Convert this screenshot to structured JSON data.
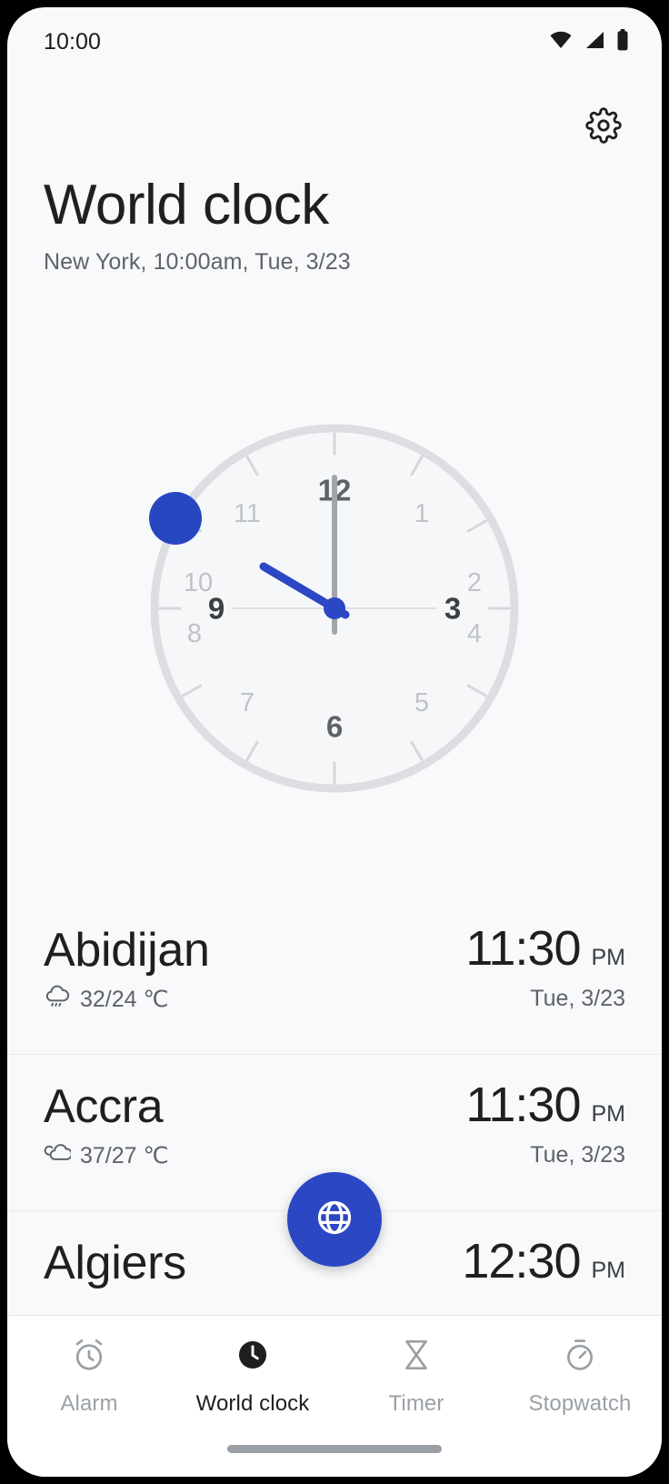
{
  "statusbar": {
    "time": "10:00",
    "icons": [
      "wifi-icon",
      "cellular-signal-icon",
      "battery-icon"
    ]
  },
  "header": {
    "settings_icon": "gear-icon",
    "title": "World clock",
    "subtitle": "New York, 10:00am, Tue, 3/23"
  },
  "clock": {
    "numbers": [
      "12",
      "1",
      "2",
      "3",
      "4",
      "5",
      "6",
      "7",
      "8",
      "9",
      "10",
      "11"
    ],
    "major_numbers": [
      "12",
      "3",
      "6",
      "9"
    ],
    "hour_hand_position": "10",
    "minute_hand_position": "12",
    "marker_dot_position": "10",
    "accent_color": "#2B47C4",
    "ring_color": "#DADCE0",
    "face_color": "#F5F6F8",
    "minute_hand_color": "#9AA0A6"
  },
  "cities": [
    {
      "name": "Abidijan",
      "weather_icon": "rain-cloud-icon",
      "temperature": "32/24 ℃",
      "time": "11:30",
      "ampm": "PM",
      "date": "Tue, 3/23"
    },
    {
      "name": "Accra",
      "weather_icon": "partly-cloudy-icon",
      "temperature": "37/27 ℃",
      "time": "11:30",
      "ampm": "PM",
      "date": "Tue, 3/23"
    },
    {
      "name": "Algiers",
      "weather_icon": "",
      "temperature": "",
      "time": "12:30",
      "ampm": "PM",
      "date": ""
    }
  ],
  "fab": {
    "icon": "globe-icon",
    "color": "#2B47C4"
  },
  "bottom_nav": {
    "items": [
      {
        "label": "Alarm",
        "icon": "alarm-clock-icon",
        "active": false
      },
      {
        "label": "World clock",
        "icon": "clock-filled-icon",
        "active": true
      },
      {
        "label": "Timer",
        "icon": "hourglass-icon",
        "active": false
      },
      {
        "label": "Stopwatch",
        "icon": "stopwatch-icon",
        "active": false
      }
    ]
  }
}
